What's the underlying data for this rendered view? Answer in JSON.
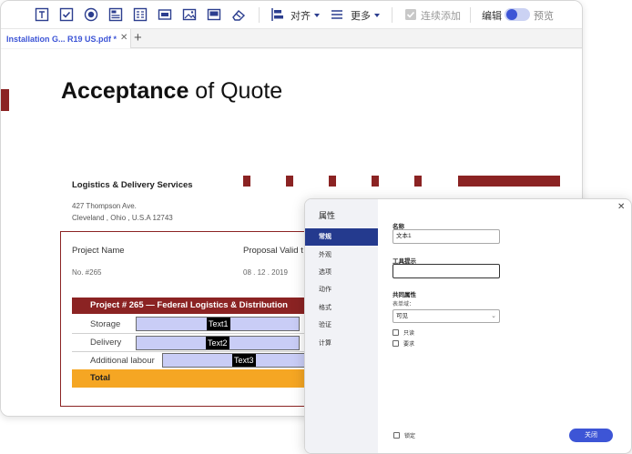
{
  "toolbar": {
    "align_label": "对齐",
    "more_label": "更多",
    "continuous_add_label": "连续添加",
    "edit_label": "编辑",
    "preview_label": "预览",
    "accent": "#2c3e8f"
  },
  "tab": {
    "title": "Installation  G... R19 US.pdf *",
    "close": "✕",
    "add": "+"
  },
  "document": {
    "title_bold": "Acceptance",
    "title_rest": " of Quote",
    "company": "Logistics & Delivery Services",
    "address_line1": "427 Thompson Ave.",
    "address_line2": "Cleveland , Ohio , U.S.A 12743",
    "project_name_label": "Project Name",
    "project_name_value": "No. #265",
    "proposal_label": "Proposal Valid t",
    "proposal_value": "08 . 12 . 2019",
    "project_bar": "Project # 265 — Federal Logistics & Distribution",
    "rows": [
      {
        "label": "Storage",
        "field": "Text1"
      },
      {
        "label": "Delivery",
        "field": "Text2"
      },
      {
        "label": "Additional labour",
        "field": "Text3"
      }
    ],
    "total_label": "Total",
    "brand_red": "#8b2323",
    "total_color": "#f5a623",
    "field_color": "#c9cdf6"
  },
  "dialog": {
    "title": "属性",
    "nav": [
      "常规",
      "外观",
      "选项",
      "动作",
      "格式",
      "验证",
      "计算"
    ],
    "active_nav": "常规",
    "name_label": "名称",
    "name_value": "文本1",
    "tooltip_label": "工具提示",
    "tooltip_value": "",
    "common_label": "共同属性",
    "form_field_label": "表单域：",
    "visibility_value": "可见",
    "readonly_label": "只读",
    "required_label": "要求",
    "lock_label": "锁定",
    "close_button": "关闭",
    "close_icon": "✕"
  }
}
